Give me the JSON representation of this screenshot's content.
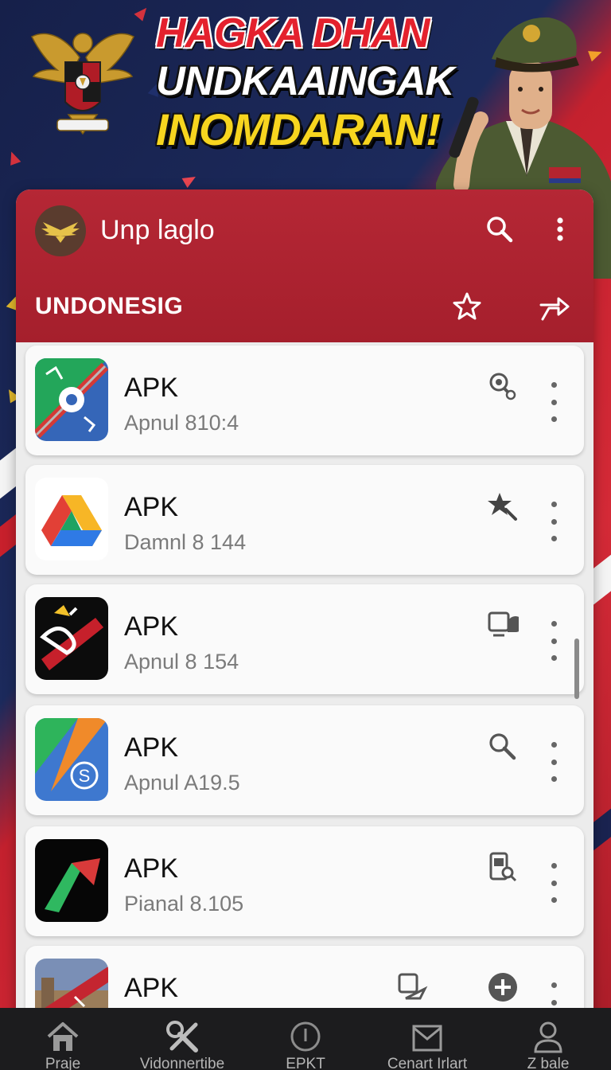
{
  "banner": {
    "headline_line1": "HAGKA DHAN",
    "headline_line2": "UNDKAAINGAK",
    "headline_line3": "INOMDARAN!"
  },
  "appbar": {
    "title": "Unp laglo",
    "section_label": "UNDONESIG",
    "icons": [
      "search-icon",
      "more-vert-icon",
      "star-icon",
      "share-icon"
    ]
  },
  "list": {
    "items": [
      {
        "name": "APK",
        "version": "Apnul 810:4",
        "action_icon": "settings-search-icon"
      },
      {
        "name": "APK",
        "version": "Damnl 8 144",
        "action_icon": "pin-icon"
      },
      {
        "name": "APK",
        "version": "Apnul 8 154",
        "action_icon": "device-icon"
      },
      {
        "name": "APK",
        "version": "Apnul A19.5",
        "action_icon": "search-icon"
      },
      {
        "name": "APK",
        "version": "Pianal 8.105",
        "action_icon": "device-search-icon"
      },
      {
        "name": "APK",
        "version": "",
        "action_icon": "edit-icon"
      }
    ]
  },
  "bottom_nav": {
    "items": [
      {
        "label": "Praje",
        "icon": "home-icon"
      },
      {
        "label": "Vidonnertibe",
        "icon": "tools-icon"
      },
      {
        "label": "EPKT",
        "icon": "info-icon"
      },
      {
        "label": "Cenart Irlart",
        "icon": "mail-icon"
      },
      {
        "label": "Z bale",
        "icon": "user-icon"
      }
    ]
  },
  "colors": {
    "appbar": "#a8212e",
    "navy": "#1c2a5c",
    "headline_red": "#e4212d",
    "headline_yellow": "#f7d51f",
    "nav_bg": "#1c1c1e"
  }
}
